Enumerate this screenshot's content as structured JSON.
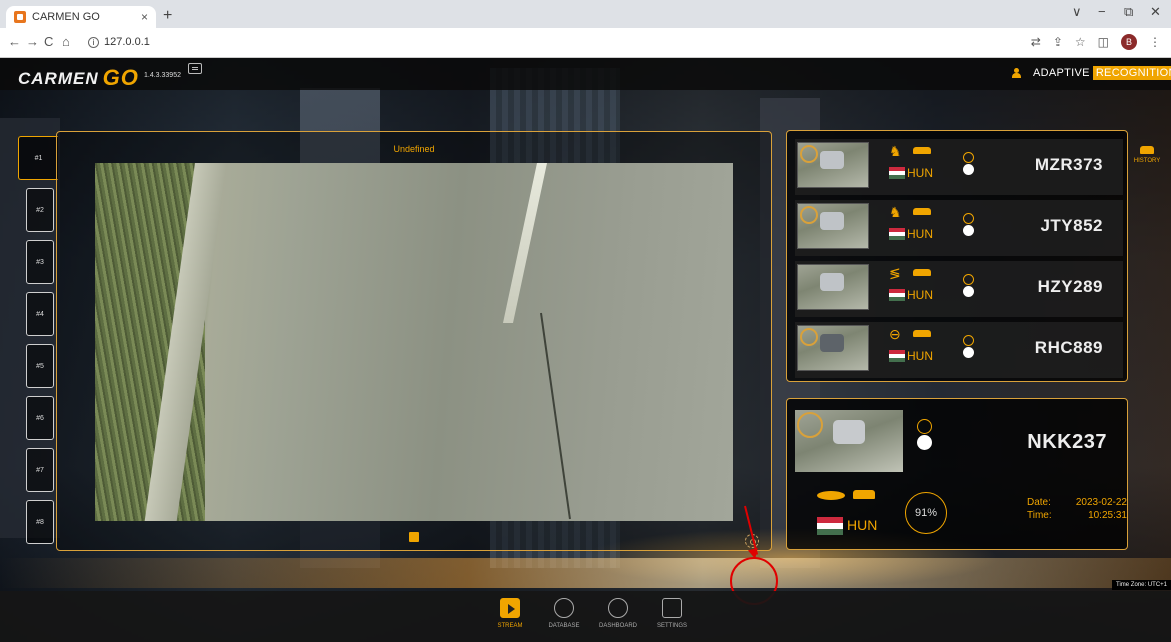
{
  "browser": {
    "tab_title": "CARMEN GO",
    "tab_close": "×",
    "new_tab": "+",
    "url": "127.0.0.1",
    "window_controls": [
      "∨",
      "−",
      "⧉",
      "✕"
    ],
    "profile_initial": "B"
  },
  "app": {
    "logo_text": "CARMEN",
    "logo_go": "GO",
    "version": "1.4.3.33952",
    "brand_part1": "ADAPTIVE",
    "brand_part2": "RECOGNITION",
    "accent_color": "#f0a500"
  },
  "camera_tabs": [
    "#1",
    "#2",
    "#3",
    "#4",
    "#5",
    "#6",
    "#7",
    "#8"
  ],
  "stream": {
    "label": "Undefined"
  },
  "recent_reads": [
    {
      "plate": "MZR373",
      "country": "HUN",
      "brand_icon": "peugeot-icon",
      "vehicle_icon": "van-icon"
    },
    {
      "plate": "JTY852",
      "country": "HUN",
      "brand_icon": "peugeot-icon",
      "vehicle_icon": "car-icon"
    },
    {
      "plate": "HZY289",
      "country": "HUN",
      "brand_icon": "suzuki-icon",
      "vehicle_icon": "car-icon"
    },
    {
      "plate": "RHC889",
      "country": "HUN",
      "brand_icon": "opel-icon",
      "vehicle_icon": "van-icon"
    }
  ],
  "history_label": "HISTORY",
  "detail": {
    "plate": "NKK237",
    "country": "HUN",
    "confidence": "91%",
    "date_label": "Date:",
    "date_value": "2023-02-22",
    "time_label": "Time:",
    "time_value": "10:25:31",
    "brand_icon": "ford-icon",
    "vehicle_icon": "car-icon"
  },
  "timezone": "Time Zone: UTC+1",
  "bottom_nav": [
    {
      "label": "STREAM",
      "icon": "play-icon",
      "active": true
    },
    {
      "label": "DATABASE",
      "icon": "database-icon",
      "active": false
    },
    {
      "label": "DASHBOARD",
      "icon": "dashboard-icon",
      "active": false
    },
    {
      "label": "SETTINGS",
      "icon": "settings-icon",
      "active": false
    }
  ]
}
